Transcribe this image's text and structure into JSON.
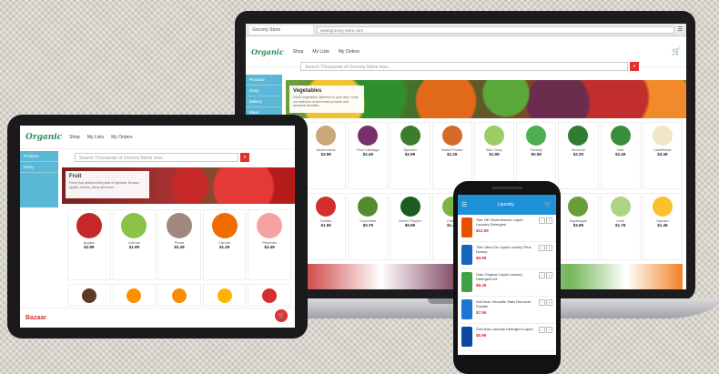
{
  "icons": {
    "search": "search-icon",
    "cart": "cart-icon",
    "menu": "menu-icon",
    "cart_fab": "cart-icon"
  },
  "colors": {
    "brand_green": "#2e8b57",
    "brand_red": "#d52b2b",
    "sidebar_blue": "#5bb7d6",
    "phone_header_blue": "#1e90d6"
  },
  "laptop": {
    "tab_label": "Grocery Store",
    "address_url": "www.grocery-store.com",
    "logo_main": "Organic",
    "logo_sub": "",
    "nav": [
      "Shop",
      "My Lists",
      "My Orders"
    ],
    "search_placeholder": "Search Thousands of Grocery Items now...",
    "sidebar_items": [
      "Produce",
      "Dairy",
      "Bakery",
      "Meat",
      "Pantry"
    ],
    "hero_title": "Vegetables",
    "hero_text": "Fresh vegetables delivered to your door. Shop our selection of farm fresh produce and seasonal favorites.",
    "products_row1": [
      {
        "name": "Mushrooms",
        "price": "$3.99",
        "color": "#c9a77a"
      },
      {
        "name": "Red Cabbage",
        "price": "$2.49",
        "color": "#7a2f6a"
      },
      {
        "name": "Spinach",
        "price": "$2.99",
        "color": "#3c7d2c"
      },
      {
        "name": "Sweet Potato",
        "price": "$1.29",
        "color": "#d46a2a"
      },
      {
        "name": "Bok Choy",
        "price": "$1.99",
        "color": "#9ccc65"
      },
      {
        "name": "Parsley",
        "price": "$0.99",
        "color": "#4caf50"
      },
      {
        "name": "Broccoli",
        "price": "$2.29",
        "color": "#2e7d32"
      },
      {
        "name": "Kale",
        "price": "$2.49",
        "color": "#388e3c"
      },
      {
        "name": "Cauliflower",
        "price": "$3.49",
        "color": "#efe6c8"
      }
    ],
    "products_row2": [
      {
        "name": "Tomato",
        "price": "$1.99",
        "color": "#d32f2f"
      },
      {
        "name": "Cucumber",
        "price": "$0.79",
        "color": "#558b2f"
      },
      {
        "name": "Green Pepper",
        "price": "$0.99",
        "color": "#1b5e20"
      },
      {
        "name": "Celery",
        "price": "$1.49",
        "color": "#7cb342"
      },
      {
        "name": "Romaine",
        "price": "$2.29",
        "color": "#8bc34a"
      },
      {
        "name": "Green Beans",
        "price": "$2.99",
        "color": "#4e8a2b"
      },
      {
        "name": "Asparagus",
        "price": "$3.99",
        "color": "#689f38"
      },
      {
        "name": "Leek",
        "price": "$1.79",
        "color": "#aed581"
      },
      {
        "name": "Squash",
        "price": "$1.49",
        "color": "#fbc02d"
      }
    ]
  },
  "tablet": {
    "logo_main": "Organic",
    "nav": [
      "Shop",
      "My Lists",
      "My Orders"
    ],
    "search_placeholder": "Search Thousands of Grocery Items now...",
    "sidebar_items": [
      "Produce",
      "Dairy"
    ],
    "hero_title": "Fruit",
    "hero_text": "Fresh fruit picked at the peak of ripeness. Browse apples, berries, citrus and more.",
    "products": [
      {
        "name": "Apples",
        "price": "$2.99",
        "color": "#c62828"
      },
      {
        "name": "Lettuce",
        "price": "$1.99",
        "color": "#8bc34a"
      },
      {
        "name": "Pears",
        "price": "$2.49",
        "color": "#a1887f"
      },
      {
        "name": "Carrots",
        "price": "$1.29",
        "color": "#ef6c00"
      },
      {
        "name": "Peaches",
        "price": "$3.49",
        "color": "#f4a3a0"
      }
    ],
    "products_row2_colors": [
      "#5d3a2a",
      "#ff8f00",
      "#fb8c00",
      "#ffb300",
      "#d32f2f"
    ],
    "footer_brand": "Bazaar"
  },
  "phone": {
    "title": "Laundry",
    "items": [
      {
        "name": "Tide HE Clean Breeze Liquid Laundry Detergent",
        "price": "$12.99",
        "color": "#e65100"
      },
      {
        "name": "Tide Ultra Oxi Liquid Laundry Plus Downy",
        "price": "$9.99",
        "color": "#1565c0"
      },
      {
        "name": "Gain Original Liquid Laundry Detergent 64",
        "price": "$8.49",
        "color": "#43a047"
      },
      {
        "name": "OxiClean Versatile Stain Remover Powder",
        "price": "$7.99",
        "color": "#1976d2"
      },
      {
        "name": "OxiClean Laundry Detergent Liquid",
        "price": "$6.99",
        "color": "#0d47a1"
      }
    ]
  }
}
